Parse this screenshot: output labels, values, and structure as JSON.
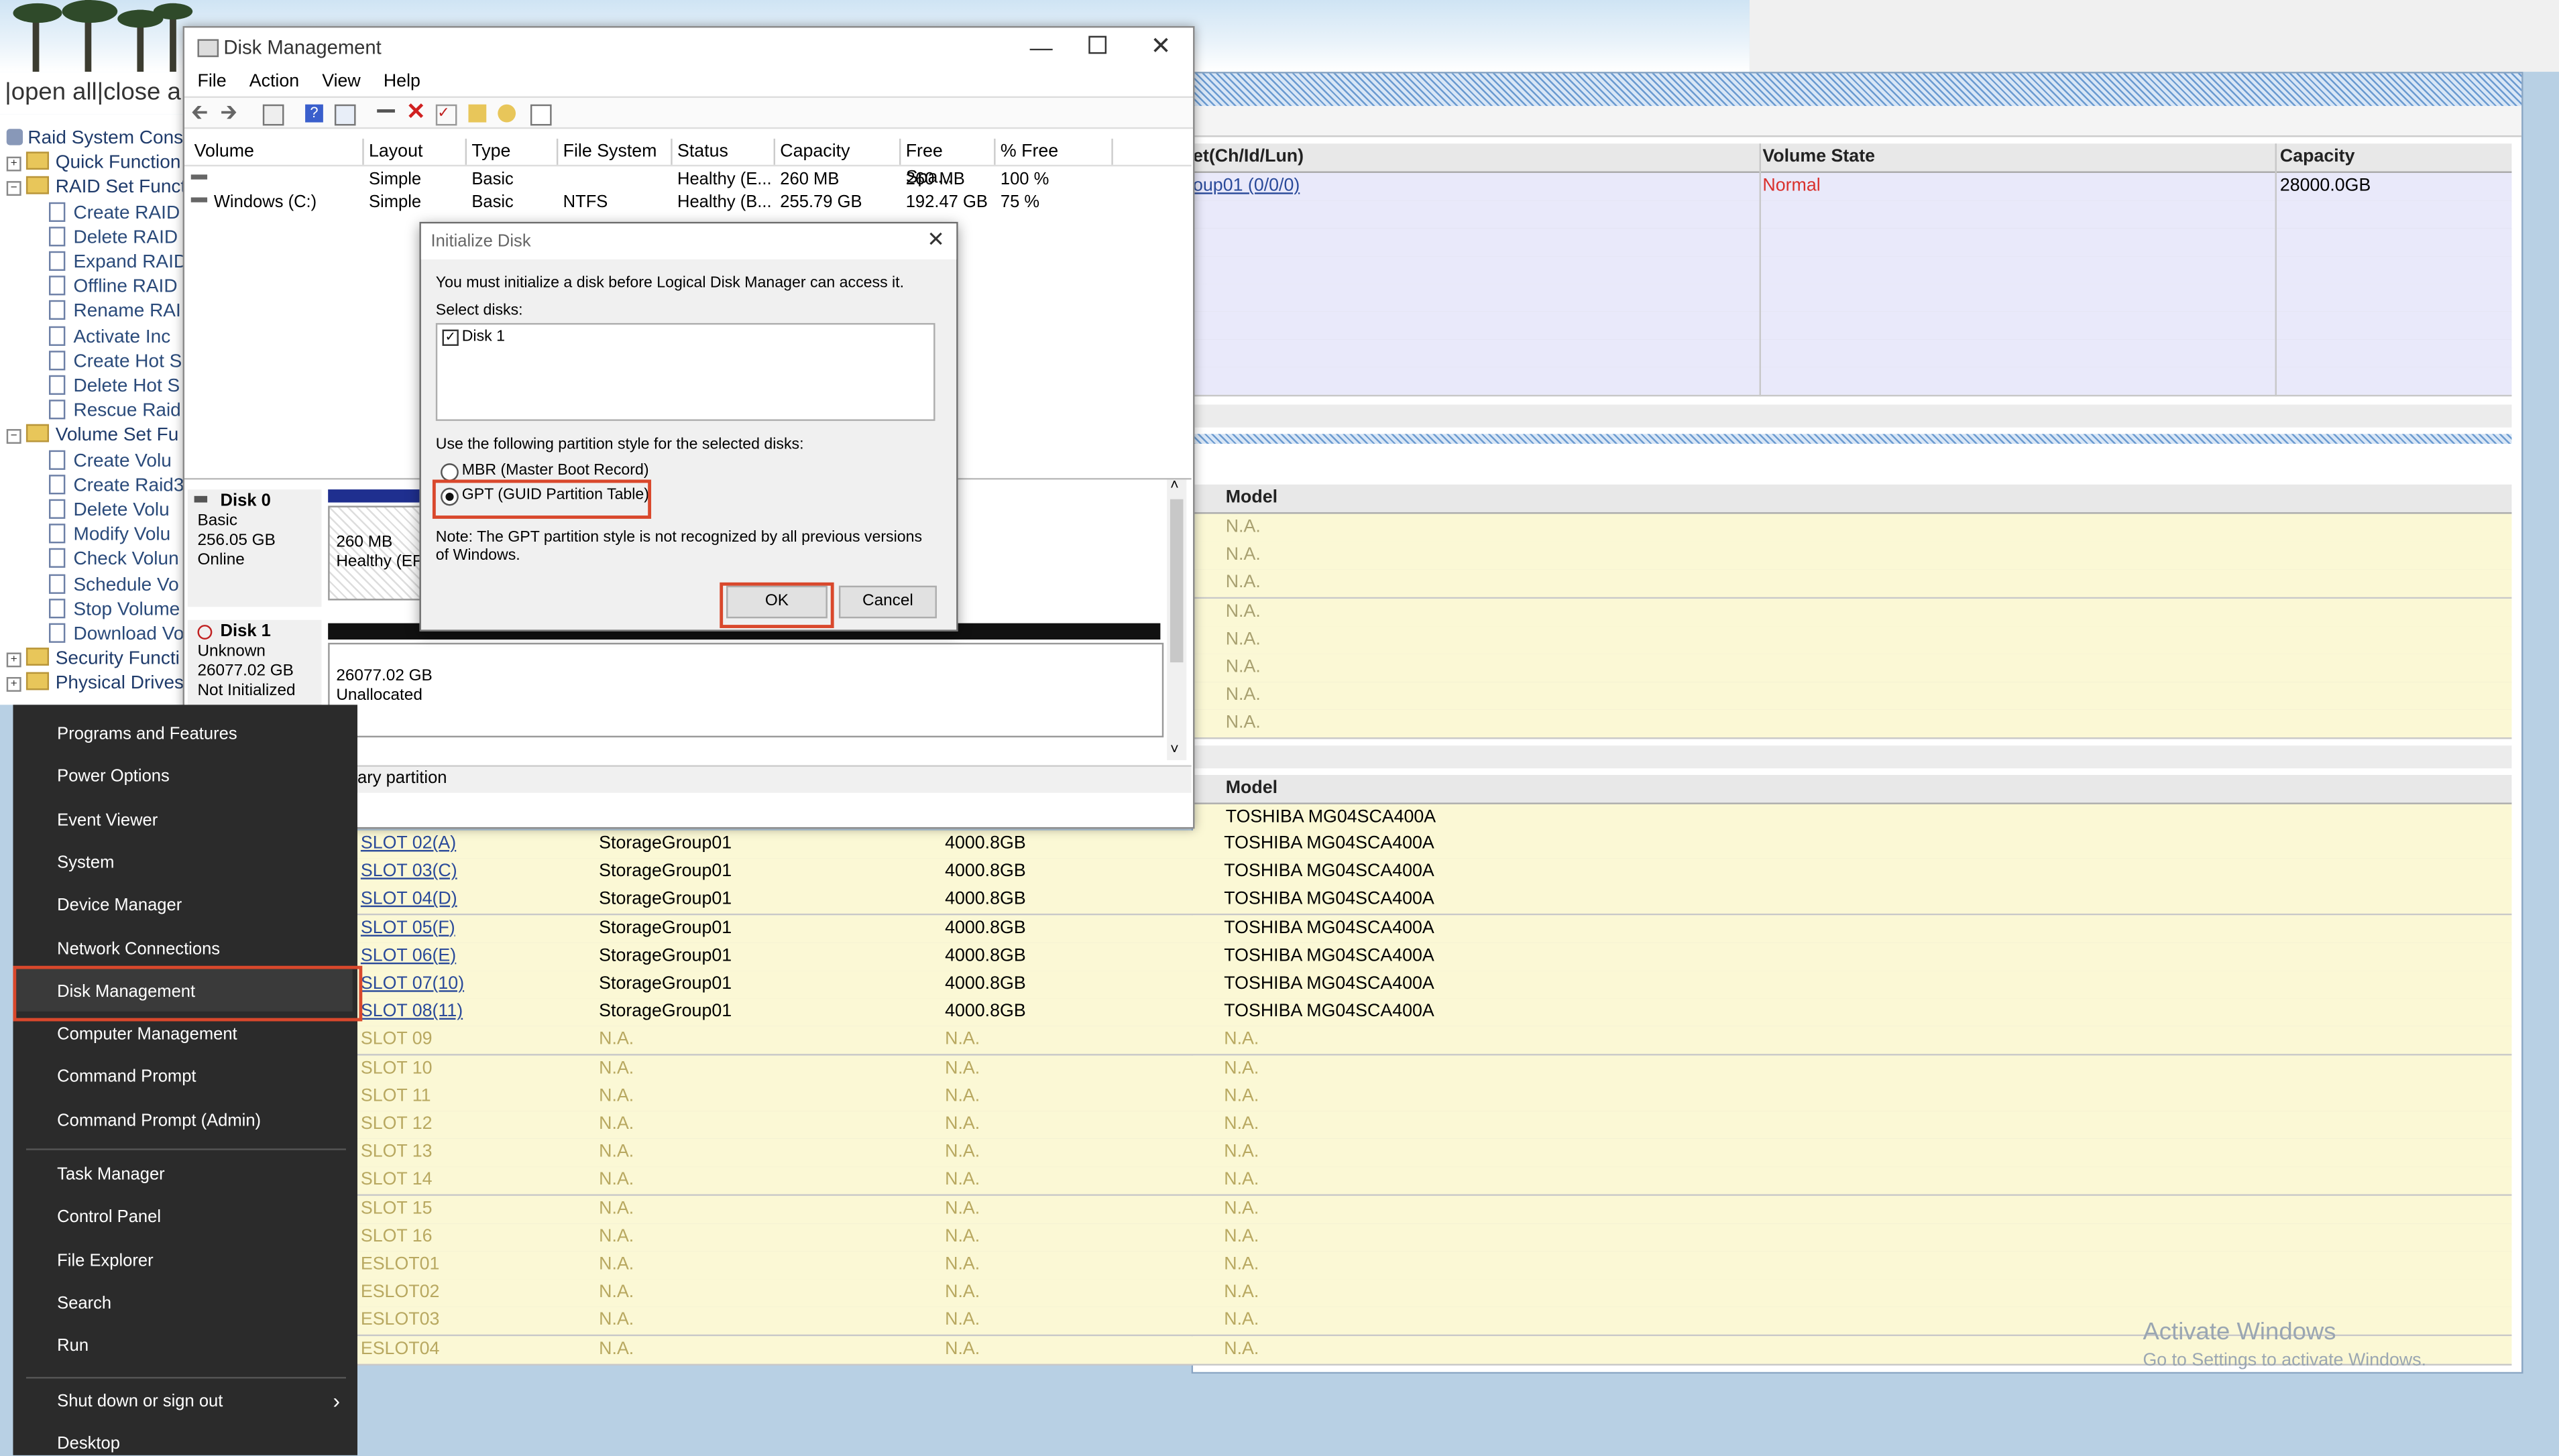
{
  "banner": {
    "open_close": "|open all|close a"
  },
  "tree": {
    "items": [
      {
        "label": "Raid System Cons",
        "level": 0,
        "kind": "root"
      },
      {
        "label": "Quick Function",
        "level": 0,
        "kind": "folder"
      },
      {
        "label": "RAID Set Funct",
        "level": 0,
        "kind": "folder-open"
      },
      {
        "label": "Create RAID",
        "level": 1,
        "kind": "doc"
      },
      {
        "label": "Delete RAID",
        "level": 1,
        "kind": "doc"
      },
      {
        "label": "Expand RAID",
        "level": 1,
        "kind": "doc"
      },
      {
        "label": "Offline RAID",
        "level": 1,
        "kind": "doc"
      },
      {
        "label": "Rename RAI",
        "level": 1,
        "kind": "doc"
      },
      {
        "label": "Activate Inc",
        "level": 1,
        "kind": "doc"
      },
      {
        "label": "Create Hot S",
        "level": 1,
        "kind": "doc"
      },
      {
        "label": "Delete Hot S",
        "level": 1,
        "kind": "doc"
      },
      {
        "label": "Rescue Raid",
        "level": 1,
        "kind": "doc"
      },
      {
        "label": "Volume Set Fu",
        "level": 0,
        "kind": "folder-open"
      },
      {
        "label": "Create Volu",
        "level": 1,
        "kind": "doc"
      },
      {
        "label": "Create Raid3",
        "level": 1,
        "kind": "doc"
      },
      {
        "label": "Delete Volu",
        "level": 1,
        "kind": "doc"
      },
      {
        "label": "Modify Volu",
        "level": 1,
        "kind": "doc"
      },
      {
        "label": "Check Volun",
        "level": 1,
        "kind": "doc"
      },
      {
        "label": "Schedule Vo",
        "level": 1,
        "kind": "doc"
      },
      {
        "label": "Stop Volume",
        "level": 1,
        "kind": "doc"
      },
      {
        "label": "Download Vo",
        "level": 1,
        "kind": "doc"
      },
      {
        "label": "Security Functi",
        "level": 0,
        "kind": "folder"
      },
      {
        "label": "Physical Drives",
        "level": 0,
        "kind": "folder"
      }
    ]
  },
  "volume_table": {
    "headers": [
      "et(Ch/Id/Lun)",
      "Volume State",
      "Capacity"
    ],
    "row": {
      "name": "oup01 (0/0/0)",
      "state": "Normal",
      "capacity": "28000.0GB"
    },
    "state_color": "#d9302c"
  },
  "model_table1": {
    "header": "Model",
    "rows": [
      "N.A.",
      "N.A.",
      "N.A.",
      "N.A.",
      "N.A.",
      "N.A.",
      "N.A.",
      "N.A."
    ]
  },
  "model_table2": {
    "header": "Model",
    "top_partial": "TOSHIBA MG04SCA400A",
    "rows": [
      {
        "slot": "SLOT 02(A)",
        "group": "StorageGroup01",
        "cap": "4000.8GB",
        "model": "TOSHIBA MG04SCA400A",
        "active": true
      },
      {
        "slot": "SLOT 03(C)",
        "group": "StorageGroup01",
        "cap": "4000.8GB",
        "model": "TOSHIBA MG04SCA400A",
        "active": true
      },
      {
        "slot": "SLOT 04(D)",
        "group": "StorageGroup01",
        "cap": "4000.8GB",
        "model": "TOSHIBA MG04SCA400A",
        "active": true
      },
      {
        "slot": "SLOT 05(F)",
        "group": "StorageGroup01",
        "cap": "4000.8GB",
        "model": "TOSHIBA MG04SCA400A",
        "active": true
      },
      {
        "slot": "SLOT 06(E)",
        "group": "StorageGroup01",
        "cap": "4000.8GB",
        "model": "TOSHIBA MG04SCA400A",
        "active": true
      },
      {
        "slot": "SLOT 07(10)",
        "group": "StorageGroup01",
        "cap": "4000.8GB",
        "model": "TOSHIBA MG04SCA400A",
        "active": true
      },
      {
        "slot": "SLOT 08(11)",
        "group": "StorageGroup01",
        "cap": "4000.8GB",
        "model": "TOSHIBA MG04SCA400A",
        "active": true
      },
      {
        "slot": "SLOT 09",
        "group": "N.A.",
        "cap": "N.A.",
        "model": "N.A.",
        "active": false
      },
      {
        "slot": "SLOT 10",
        "group": "N.A.",
        "cap": "N.A.",
        "model": "N.A.",
        "active": false
      },
      {
        "slot": "SLOT 11",
        "group": "N.A.",
        "cap": "N.A.",
        "model": "N.A.",
        "active": false
      },
      {
        "slot": "SLOT 12",
        "group": "N.A.",
        "cap": "N.A.",
        "model": "N.A.",
        "active": false
      },
      {
        "slot": "SLOT 13",
        "group": "N.A.",
        "cap": "N.A.",
        "model": "N.A.",
        "active": false
      },
      {
        "slot": "SLOT 14",
        "group": "N.A.",
        "cap": "N.A.",
        "model": "N.A.",
        "active": false
      },
      {
        "slot": "SLOT 15",
        "group": "N.A.",
        "cap": "N.A.",
        "model": "N.A.",
        "active": false
      },
      {
        "slot": "SLOT 16",
        "group": "N.A.",
        "cap": "N.A.",
        "model": "N.A.",
        "active": false
      },
      {
        "slot": "ESLOT01",
        "group": "N.A.",
        "cap": "N.A.",
        "model": "N.A.",
        "active": false
      },
      {
        "slot": "ESLOT02",
        "group": "N.A.",
        "cap": "N.A.",
        "model": "N.A.",
        "active": false
      },
      {
        "slot": "ESLOT03",
        "group": "N.A.",
        "cap": "N.A.",
        "model": "N.A.",
        "active": false
      },
      {
        "slot": "ESLOT04",
        "group": "N.A.",
        "cap": "N.A.",
        "model": "N.A.",
        "active": false
      }
    ]
  },
  "disk_mgmt": {
    "title": "Disk Management",
    "menu": [
      "File",
      "Action",
      "View",
      "Help"
    ],
    "columns": [
      "Volume",
      "Layout",
      "Type",
      "File System",
      "Status",
      "Capacity",
      "Free Spa...",
      "% Free"
    ],
    "volumes": [
      {
        "volume": "",
        "layout": "Simple",
        "type": "Basic",
        "fs": "",
        "status": "Healthy (E...",
        "capacity": "260 MB",
        "free": "260 MB",
        "pct": "100 %"
      },
      {
        "volume": "Windows (C:)",
        "layout": "Simple",
        "type": "Basic",
        "fs": "NTFS",
        "status": "Healthy (B...",
        "capacity": "255.79 GB",
        "free": "192.47 GB",
        "pct": "75 %"
      }
    ],
    "disk0": {
      "name": "Disk 0",
      "type": "Basic",
      "size": "256.05 GB",
      "state": "Online",
      "part_size": "260 MB",
      "part_status": "Healthy (EFI"
    },
    "disk1": {
      "name": "Disk 1",
      "type": "Unknown",
      "size": "26077.02 GB",
      "state": "Not Initialized",
      "part_size": "26077.02 GB",
      "part_status": "Unallocated"
    },
    "legend": "ary partition"
  },
  "dialog": {
    "title": "Initialize Disk",
    "message": "You must initialize a disk before Logical Disk Manager can access it.",
    "select_label": "Select disks:",
    "disk_item": "Disk 1",
    "partition_label": "Use the following partition style for the selected disks:",
    "mbr": "MBR (Master Boot Record)",
    "gpt": "GPT (GUID Partition Table)",
    "note": "Note: The GPT partition style is not recognized by all previous versions of Windows.",
    "ok": "OK",
    "cancel": "Cancel"
  },
  "winx_menu": {
    "items": [
      "Programs and Features",
      "Power Options",
      "Event Viewer",
      "System",
      "Device Manager",
      "Network Connections",
      "Disk Management",
      "Computer Management",
      "Command Prompt",
      "Command Prompt (Admin)"
    ],
    "items2": [
      "Task Manager",
      "Control Panel",
      "File Explorer",
      "Search",
      "Run"
    ],
    "shutdown": "Shut down or sign out",
    "desktop": "Desktop",
    "highlight": "Disk Management"
  },
  "watermark": {
    "line1": "Activate Windows",
    "line2": "Go to Settings to activate Windows."
  },
  "colors": {
    "highlight_box": "#d9482c",
    "link": "#2a4a9a",
    "lavender": "#e9e9fa",
    "yellow": "#fbf8d5"
  }
}
